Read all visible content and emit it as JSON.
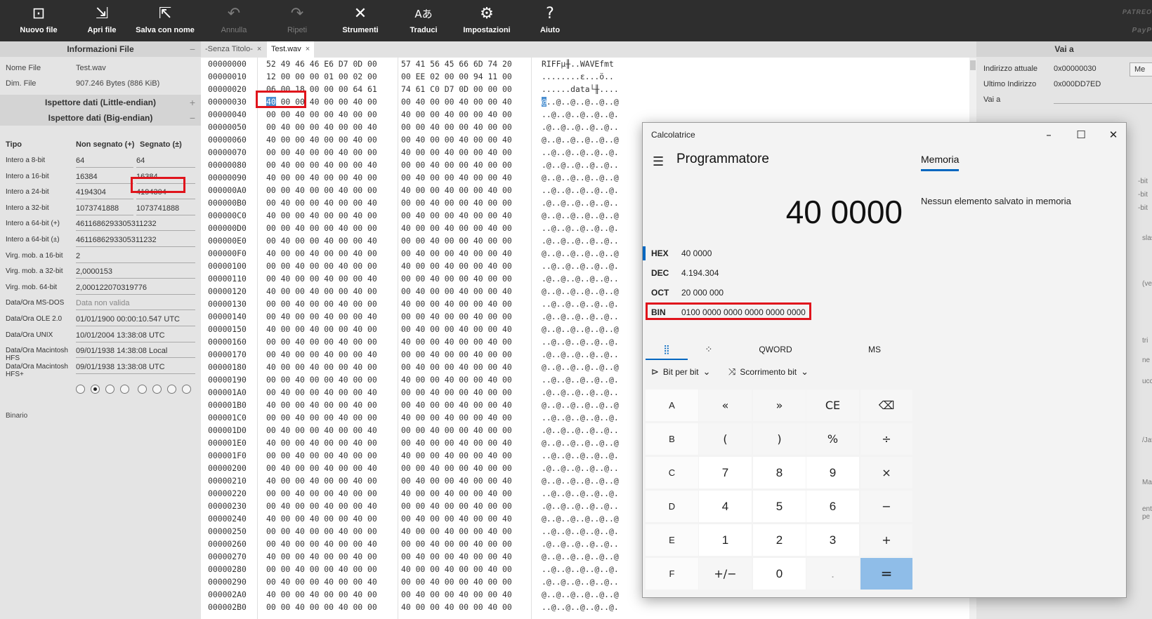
{
  "toolbar": {
    "items": [
      {
        "label": "Nuovo file",
        "icon": "new-file-icon",
        "glyph": "⊡"
      },
      {
        "label": "Apri file",
        "icon": "open-file-icon",
        "glyph": "⇲"
      },
      {
        "label": "Salva con nome",
        "icon": "save-as-icon",
        "glyph": "⇱"
      },
      {
        "label": "Annulla",
        "icon": "undo-icon",
        "glyph": "↶"
      },
      {
        "label": "Ripeti",
        "icon": "redo-icon",
        "glyph": "↷"
      },
      {
        "label": "Strumenti",
        "icon": "tools-icon",
        "glyph": "✕"
      },
      {
        "label": "Traduci",
        "icon": "translate-icon",
        "glyph": "Aあ"
      },
      {
        "label": "Impostazioni",
        "icon": "settings-icon",
        "glyph": "⚙"
      },
      {
        "label": "Aiuto",
        "icon": "help-icon",
        "glyph": "?"
      }
    ],
    "right_top": "PATREO",
    "right_bottom": "PayP"
  },
  "file_info": {
    "title": "Informazioni File",
    "name_label": "Nome File",
    "name_value": "Test.wav",
    "size_label": "Dim. File",
    "size_value": "907.246 Bytes (886 KiB)"
  },
  "inspector": {
    "le_title": "Ispettore dati (Little-endian)",
    "be_title": "Ispettore dati (Big-endian)",
    "col_type": "Tipo",
    "col_unsigned": "Non segnato (+)",
    "col_signed": "Segnato (±)",
    "rows": [
      {
        "k": "Intero a 8-bit",
        "u": "64",
        "s": "64"
      },
      {
        "k": "Intero a 16-bit",
        "u": "16384",
        "s": "16384"
      },
      {
        "k": "Intero a 24-bit",
        "u": "4194304",
        "s": "4194304"
      },
      {
        "k": "Intero a 32-bit",
        "u": "1073741888",
        "s": "1073741888"
      },
      {
        "k": "Intero a 64-bit (+)",
        "u": "4611686293305311232"
      },
      {
        "k": "Intero a 64-bit (±)",
        "u": "4611686293305311232"
      },
      {
        "k": "Virg. mob. a 16-bit",
        "u": "2"
      },
      {
        "k": "Virg. mob. a 32-bit",
        "u": "2,0000153"
      },
      {
        "k": "Virg. mob. 64-bit",
        "u": "2,000122070319776"
      },
      {
        "k": "Data/Ora MS-DOS",
        "u": "Data non valida"
      },
      {
        "k": "Data/Ora OLE 2.0",
        "u": "01/01/1900 00:00:10.547 UTC"
      },
      {
        "k": "Data/Ora UNIX",
        "u": "10/01/2004 13:38:08 UTC"
      },
      {
        "k": "Data/Ora Macintosh HFS",
        "u": "09/01/1938 14:38:08 Local"
      },
      {
        "k": "Data/Ora Macintosh HFS+",
        "u": "09/01/1938 13:38:08 UTC"
      }
    ],
    "binary_label": "Binario"
  },
  "tabs": [
    {
      "label": "-Senza Titolo-"
    },
    {
      "label": "Test.wav"
    }
  ],
  "hex": {
    "rows": [
      {
        "off": "00000000",
        "b1": "52 49 46 46 E6 D7 0D 00",
        "b2": "57 41 56 45 66 6D 74 20",
        "asc": "RIFFµ╫..WAVEfmt "
      },
      {
        "off": "00000010",
        "b1": "12 00 00 00 01 00 02 00",
        "b2": "00 EE 02 00 00 94 11 00",
        "asc": "........ε...ö.."
      },
      {
        "off": "00000020",
        "b1": "06 00 18 00 00 00 64 61",
        "b2": "74 61 C0 D7 0D 00 00 00",
        "asc": "......data└╫...."
      },
      {
        "off": "00000030",
        "b1": "40 00 00 40 00 00 40 00",
        "b2": "00 40 00 00 40 00 00 40",
        "asc": "@..@..@..@..@..@"
      },
      {
        "off": "00000040",
        "b1": "00 00 40 00 00 40 00 00",
        "b2": "40 00 00 40 00 00 40 00",
        "asc": "..@..@..@..@..@."
      },
      {
        "off": "00000050",
        "b1": "00 40 00 00 40 00 00 40",
        "b2": "00 00 40 00 00 40 00 00",
        "asc": ".@..@..@..@..@.."
      },
      {
        "off": "00000060",
        "b1": "40 00 00 40 00 00 40 00",
        "b2": "00 40 00 00 40 00 00 40",
        "asc": "@..@..@..@..@..@"
      },
      {
        "off": "00000070",
        "b1": "00 00 40 00 00 40 00 00",
        "b2": "40 00 00 40 00 00 40 00",
        "asc": "..@..@..@..@..@."
      },
      {
        "off": "00000080",
        "b1": "00 40 00 00 40 00 00 40",
        "b2": "00 00 40 00 00 40 00 00",
        "asc": ".@..@..@..@..@.."
      },
      {
        "off": "00000090",
        "b1": "40 00 00 40 00 00 40 00",
        "b2": "00 40 00 00 40 00 00 40",
        "asc": "@..@..@..@..@..@"
      },
      {
        "off": "000000A0",
        "b1": "00 00 40 00 00 40 00 00",
        "b2": "40 00 00 40 00 00 40 00",
        "asc": "..@..@..@..@..@."
      },
      {
        "off": "000000B0",
        "b1": "00 40 00 00 40 00 00 40",
        "b2": "00 00 40 00 00 40 00 00",
        "asc": ".@..@..@..@..@.."
      },
      {
        "off": "000000C0",
        "b1": "40 00 00 40 00 00 40 00",
        "b2": "00 40 00 00 40 00 00 40",
        "asc": "@..@..@..@..@..@"
      },
      {
        "off": "000000D0",
        "b1": "00 00 40 00 00 40 00 00",
        "b2": "40 00 00 40 00 00 40 00",
        "asc": "..@..@..@..@..@."
      },
      {
        "off": "000000E0",
        "b1": "00 40 00 00 40 00 00 40",
        "b2": "00 00 40 00 00 40 00 00",
        "asc": ".@..@..@..@..@.."
      },
      {
        "off": "000000F0",
        "b1": "40 00 00 40 00 00 40 00",
        "b2": "00 40 00 00 40 00 00 40",
        "asc": "@..@..@..@..@..@"
      },
      {
        "off": "00000100",
        "b1": "00 00 40 00 00 40 00 00",
        "b2": "40 00 00 40 00 00 40 00",
        "asc": "..@..@..@..@..@."
      },
      {
        "off": "00000110",
        "b1": "00 40 00 00 40 00 00 40",
        "b2": "00 00 40 00 00 40 00 00",
        "asc": ".@..@..@..@..@.."
      },
      {
        "off": "00000120",
        "b1": "40 00 00 40 00 00 40 00",
        "b2": "00 40 00 00 40 00 00 40",
        "asc": "@..@..@..@..@..@"
      },
      {
        "off": "00000130",
        "b1": "00 00 40 00 00 40 00 00",
        "b2": "40 00 00 40 00 00 40 00",
        "asc": "..@..@..@..@..@."
      },
      {
        "off": "00000140",
        "b1": "00 40 00 00 40 00 00 40",
        "b2": "00 00 40 00 00 40 00 00",
        "asc": ".@..@..@..@..@.."
      },
      {
        "off": "00000150",
        "b1": "40 00 00 40 00 00 40 00",
        "b2": "00 40 00 00 40 00 00 40",
        "asc": "@..@..@..@..@..@"
      },
      {
        "off": "00000160",
        "b1": "00 00 40 00 00 40 00 00",
        "b2": "40 00 00 40 00 00 40 00",
        "asc": "..@..@..@..@..@."
      },
      {
        "off": "00000170",
        "b1": "00 40 00 00 40 00 00 40",
        "b2": "00 00 40 00 00 40 00 00",
        "asc": ".@..@..@..@..@.."
      },
      {
        "off": "00000180",
        "b1": "40 00 00 40 00 00 40 00",
        "b2": "00 40 00 00 40 00 00 40",
        "asc": "@..@..@..@..@..@"
      },
      {
        "off": "00000190",
        "b1": "00 00 40 00 00 40 00 00",
        "b2": "40 00 00 40 00 00 40 00",
        "asc": "..@..@..@..@..@."
      },
      {
        "off": "000001A0",
        "b1": "00 40 00 00 40 00 00 40",
        "b2": "00 00 40 00 00 40 00 00",
        "asc": ".@..@..@..@..@.."
      },
      {
        "off": "000001B0",
        "b1": "40 00 00 40 00 00 40 00",
        "b2": "00 40 00 00 40 00 00 40",
        "asc": "@..@..@..@..@..@"
      },
      {
        "off": "000001C0",
        "b1": "00 00 40 00 00 40 00 00",
        "b2": "40 00 00 40 00 00 40 00",
        "asc": "..@..@..@..@..@."
      },
      {
        "off": "000001D0",
        "b1": "00 40 00 00 40 00 00 40",
        "b2": "00 00 40 00 00 40 00 00",
        "asc": ".@..@..@..@..@.."
      },
      {
        "off": "000001E0",
        "b1": "40 00 00 40 00 00 40 00",
        "b2": "00 40 00 00 40 00 00 40",
        "asc": "@..@..@..@..@..@"
      },
      {
        "off": "000001F0",
        "b1": "00 00 40 00 00 40 00 00",
        "b2": "40 00 00 40 00 00 40 00",
        "asc": "..@..@..@..@..@."
      },
      {
        "off": "00000200",
        "b1": "00 40 00 00 40 00 00 40",
        "b2": "00 00 40 00 00 40 00 00",
        "asc": ".@..@..@..@..@.."
      },
      {
        "off": "00000210",
        "b1": "40 00 00 40 00 00 40 00",
        "b2": "00 40 00 00 40 00 00 40",
        "asc": "@..@..@..@..@..@"
      },
      {
        "off": "00000220",
        "b1": "00 00 40 00 00 40 00 00",
        "b2": "40 00 00 40 00 00 40 00",
        "asc": "..@..@..@..@..@."
      },
      {
        "off": "00000230",
        "b1": "00 40 00 00 40 00 00 40",
        "b2": "00 00 40 00 00 40 00 00",
        "asc": ".@..@..@..@..@.."
      },
      {
        "off": "00000240",
        "b1": "40 00 00 40 00 00 40 00",
        "b2": "00 40 00 00 40 00 00 40",
        "asc": "@..@..@..@..@..@"
      },
      {
        "off": "00000250",
        "b1": "00 00 40 00 00 40 00 00",
        "b2": "40 00 00 40 00 00 40 00",
        "asc": "..@..@..@..@..@."
      },
      {
        "off": "00000260",
        "b1": "00 40 00 00 40 00 00 40",
        "b2": "00 00 40 00 00 40 00 00",
        "asc": ".@..@..@..@..@.."
      },
      {
        "off": "00000270",
        "b1": "40 00 00 40 00 00 40 00",
        "b2": "00 40 00 00 40 00 00 40",
        "asc": "@..@..@..@..@..@"
      },
      {
        "off": "00000280",
        "b1": "00 00 40 00 00 40 00 00",
        "b2": "40 00 00 40 00 00 40 00",
        "asc": "..@..@..@..@..@."
      },
      {
        "off": "00000290",
        "b1": "00 40 00 00 40 00 00 40",
        "b2": "00 00 40 00 00 40 00 00",
        "asc": ".@..@..@..@..@.."
      },
      {
        "off": "000002A0",
        "b1": "40 00 00 40 00 00 40 00",
        "b2": "00 40 00 00 40 00 00 40",
        "asc": "@..@..@..@..@..@"
      },
      {
        "off": "000002B0",
        "b1": "00 00 40 00 00 40 00 00",
        "b2": "40 00 00 40 00 00 40 00",
        "asc": "..@..@..@..@..@."
      }
    ]
  },
  "goto": {
    "title": "Vai a",
    "current_label": "Indirizzo attuale",
    "current_value": "0x00000030",
    "last_label": "Ultimo Indirizzo",
    "last_value": "0x000DD7ED",
    "goto_label": "Vai a",
    "button_label": "Me",
    "fragments": [
      "-bit",
      "-bit",
      "-bit",
      "slashes",
      "(veloce",
      "tri",
      "ne",
      "uccess",
      "/JavaS",
      "Matteo",
      "ento pe"
    ]
  },
  "calculator": {
    "window_title": "Calcolatrice",
    "mode": "Programmatore",
    "display": "40 0000",
    "radix": [
      {
        "k": "HEX",
        "v": "40 0000"
      },
      {
        "k": "DEC",
        "v": "4.194.304"
      },
      {
        "k": "OCT",
        "v": "20 000 000"
      },
      {
        "k": "BIN",
        "v": "0100 0000 0000 0000 0000 0000"
      }
    ],
    "tabs": {
      "word": "QWORD",
      "ms": "MS"
    },
    "bitwise": "Bit per bit",
    "bitshift": "Scorrimento bit",
    "keys": [
      [
        "A",
        "«",
        "»",
        "CE",
        "⌫"
      ],
      [
        "B",
        "(",
        ")",
        "%",
        "÷"
      ],
      [
        "C",
        "7",
        "8",
        "9",
        "×"
      ],
      [
        "D",
        "4",
        "5",
        "6",
        "−"
      ],
      [
        "E",
        "1",
        "2",
        "3",
        "+"
      ],
      [
        "F",
        "+/−",
        "0",
        ".",
        "="
      ]
    ],
    "memory_title": "Memoria",
    "memory_empty": "Nessun elemento salvato in memoria"
  },
  "colors": {
    "accent": "#0067c0",
    "highlight": "#4a8fd0",
    "annotation": "#e0141c",
    "toolbar": "#2e2e2e"
  }
}
